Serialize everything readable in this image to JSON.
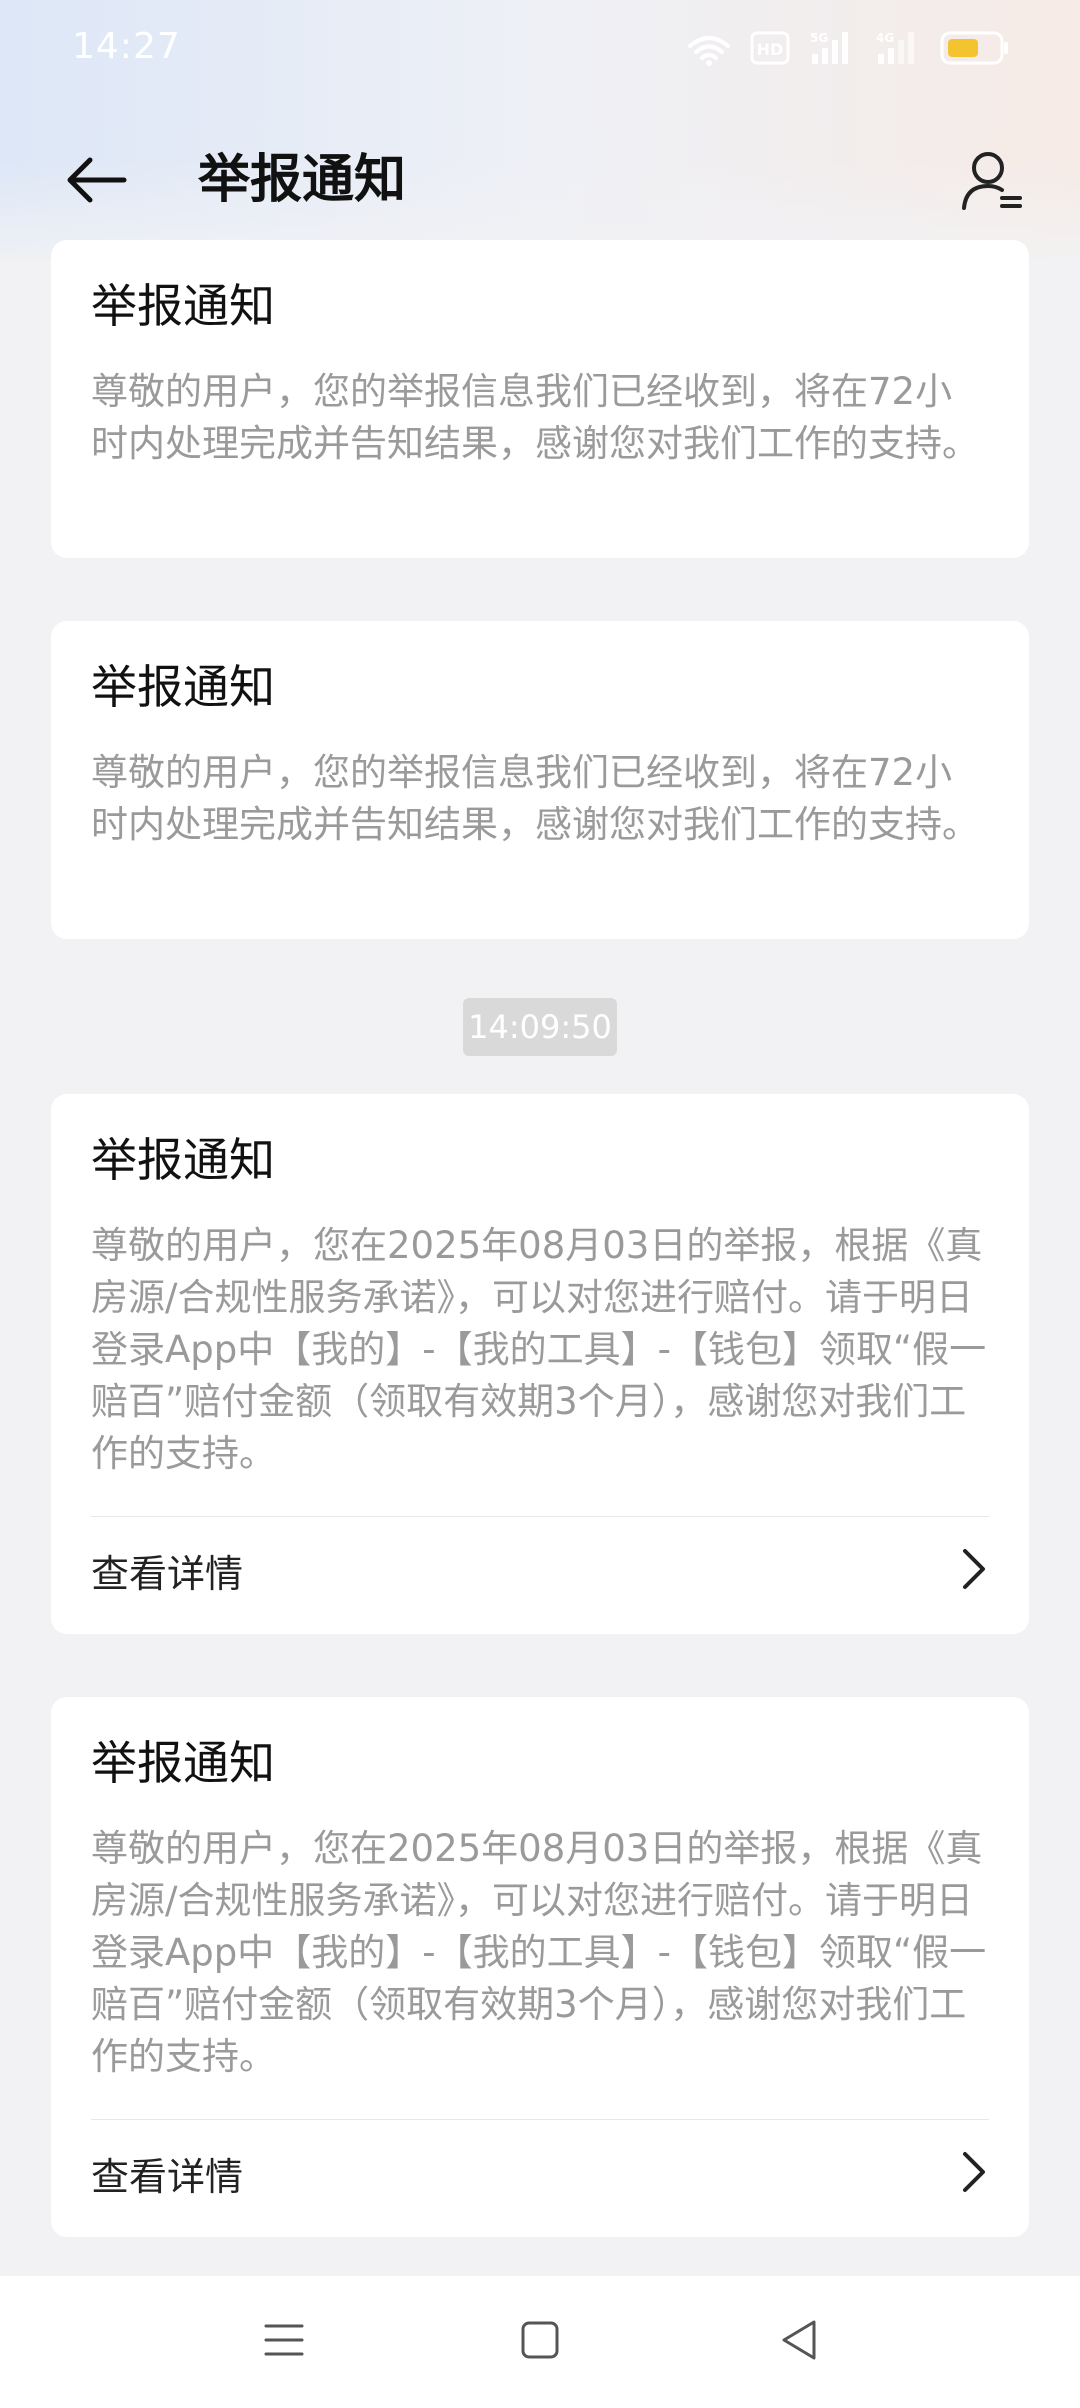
{
  "status_bar": {
    "time": "14:27",
    "icons": [
      "wifi-icon",
      "hd-icon",
      "signal-5g-icon",
      "signal-4g-icon",
      "battery-icon"
    ],
    "network_5g": "5G",
    "network_4g": "4G",
    "hd_label": "HD",
    "battery_color": "#f4c430"
  },
  "header": {
    "title": "举报通知",
    "back_icon": "arrow-left-icon",
    "user_icon": "user-settings-icon"
  },
  "cards": [
    {
      "title": "举报通知",
      "body": "尊敬的用户，您的举报信息我们已经收到，将在72小时内处理完成并告知结果，感谢您对我们工作的支持。"
    },
    {
      "title": "举报通知",
      "body": "尊敬的用户，您的举报信息我们已经收到，将在72小时内处理完成并告知结果，感谢您对我们工作的支持。"
    },
    {
      "title": "举报通知",
      "body": "尊敬的用户，您在2025年08月03日的举报，根据《真房源/合规性服务承诺》，可以对您进行赔付。请于明日登录App中【我的】-【我的工具】-【钱包】领取“假一赔百”赔付金额（领取有效期3个月），感谢您对我们工作的支持。",
      "action_label": "查看详情"
    },
    {
      "title": "举报通知",
      "body": "尊敬的用户，您在2025年08月03日的举报，根据《真房源/合规性服务承诺》，可以对您进行赔付。请于明日登录App中【我的】-【我的工具】-【钱包】领取“假一赔百”赔付金额（领取有效期3个月），感谢您对我们工作的支持。",
      "action_label": "查看详情"
    }
  ],
  "timestamp": "14:09:50",
  "nav_bar": {
    "icons": [
      "menu-icon",
      "home-square-icon",
      "back-triangle-icon"
    ]
  }
}
